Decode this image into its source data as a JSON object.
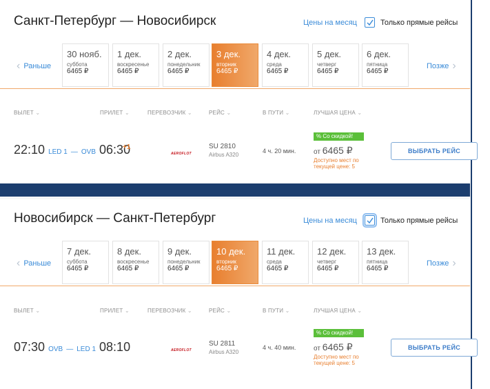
{
  "colors": {
    "accent": "#e87f2f",
    "link": "#3a8bd8",
    "discount": "#5bbf3a",
    "background": "#1b3d6e"
  },
  "legs": [
    {
      "route": "Санкт-Петербург — Новосибирск",
      "month_link": "Цены на месяц",
      "direct_only_label": "Только прямые рейсы",
      "direct_only_checked": true,
      "prev_label": "Раньше",
      "next_label": "Позже",
      "days": [
        {
          "date": "30 нояб.",
          "weekday": "суббота",
          "price": "6465 ₽"
        },
        {
          "date": "1 дек.",
          "weekday": "воскресенье",
          "price": "6465 ₽"
        },
        {
          "date": "2 дек.",
          "weekday": "понедельник",
          "price": "6465 ₽"
        },
        {
          "date": "3 дек.",
          "weekday": "вторник",
          "price": "6465 ₽"
        },
        {
          "date": "4 дек.",
          "weekday": "среда",
          "price": "6465 ₽"
        },
        {
          "date": "5 дек.",
          "weekday": "четверг",
          "price": "6465 ₽"
        },
        {
          "date": "6 дек.",
          "weekday": "пятница",
          "price": "6465 ₽"
        }
      ],
      "selected_day": 3,
      "columns": {
        "depart": "ВЫЛЕТ",
        "arrive": "ПРИЛЕТ",
        "carrier": "ПЕРЕВОЗЧИК",
        "flight": "РЕЙС",
        "duration": "В ПУТИ",
        "best_price": "ЛУЧШАЯ ЦЕНА"
      },
      "flight": {
        "dep_time": "22:10",
        "dep_airport": "LED 1",
        "dash": "—",
        "arr_airport": "OVB",
        "arr_time": "06:30",
        "day_shift": "+1",
        "carrier_logo": "AEROFLOT",
        "number": "SU 2810",
        "aircraft": "Airbus A320",
        "duration": "4 ч. 20 мин.",
        "badge": "% Со скидкой!",
        "price_from": "от",
        "price": "6465 ₽",
        "availability": "Доступно мест по текущей цене: 5",
        "button": "ВЫБРАТЬ РЕЙС"
      }
    },
    {
      "route": "Новосибирск — Санкт-Петербург",
      "month_link": "Цены на месяц",
      "direct_only_label": "Только прямые рейсы",
      "direct_only_checked": true,
      "prev_label": "Раньше",
      "next_label": "Позже",
      "days": [
        {
          "date": "7 дек.",
          "weekday": "суббота",
          "price": "6465 ₽"
        },
        {
          "date": "8 дек.",
          "weekday": "воскресенье",
          "price": "6465 ₽"
        },
        {
          "date": "9 дек.",
          "weekday": "понедельник",
          "price": "6465 ₽"
        },
        {
          "date": "10 дек.",
          "weekday": "вторник",
          "price": "6465 ₽"
        },
        {
          "date": "11 дек.",
          "weekday": "среда",
          "price": "6465 ₽"
        },
        {
          "date": "12 дек.",
          "weekday": "четверг",
          "price": "6465 ₽"
        },
        {
          "date": "13 дек.",
          "weekday": "пятница",
          "price": "6465 ₽"
        }
      ],
      "selected_day": 3,
      "columns": {
        "depart": "ВЫЛЕТ",
        "arrive": "ПРИЛЕТ",
        "carrier": "ПЕРЕВОЗЧИК",
        "flight": "РЕЙС",
        "duration": "В ПУТИ",
        "best_price": "ЛУЧШАЯ ЦЕНА"
      },
      "flight": {
        "dep_time": "07:30",
        "dep_airport": "OVB",
        "dash": "—",
        "arr_airport": "LED 1",
        "arr_time": "08:10",
        "day_shift": "",
        "carrier_logo": "AEROFLOT",
        "number": "SU 2811",
        "aircraft": "Airbus A320",
        "duration": "4 ч. 40 мин.",
        "badge": "% Со скидкой!",
        "price_from": "от",
        "price": "6465 ₽",
        "availability": "Доступно мест по текущей цене: 5",
        "button": "ВЫБРАТЬ РЕЙС"
      }
    }
  ]
}
